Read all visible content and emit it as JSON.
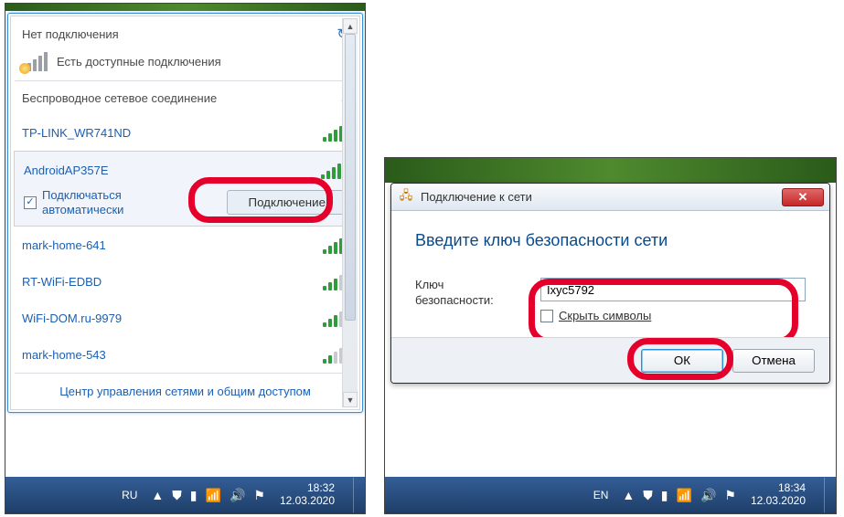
{
  "left": {
    "no_connection": "Нет подключения",
    "available": "Есть доступные подключения",
    "adapter": "Беспроводное сетевое соединение",
    "refresh_icon": "↻",
    "chevron_up": "˄",
    "auto_connect": "Подключаться\nавтоматически",
    "connect_btn": "Подключение",
    "bottom_link": "Центр управления сетями и общим доступом",
    "networks": [
      {
        "name": "TP-LINK_WR741ND",
        "strength": 4,
        "selected": false
      },
      {
        "name": "AndroidAP357E",
        "strength": 5,
        "selected": true
      },
      {
        "name": "mark-home-641",
        "strength": 4,
        "selected": false
      },
      {
        "name": "RT-WiFi-EDBD",
        "strength": 3,
        "selected": false
      },
      {
        "name": "WiFi-DOM.ru-9979",
        "strength": 3,
        "selected": false
      },
      {
        "name": "mark-home-543",
        "strength": 2,
        "selected": false
      }
    ],
    "taskbar": {
      "lang": "RU",
      "time": "18:32",
      "date": "12.03.2020"
    }
  },
  "right": {
    "title": "Подключение к сети",
    "heading": "Введите ключ безопасности сети",
    "key_label": "Ключ\nбезопасности:",
    "key_value": "Ixyc5792",
    "hide": "Скрыть символы",
    "ok": "ОК",
    "cancel": "Отмена",
    "taskbar": {
      "lang": "EN",
      "time": "18:34",
      "date": "12.03.2020"
    }
  }
}
